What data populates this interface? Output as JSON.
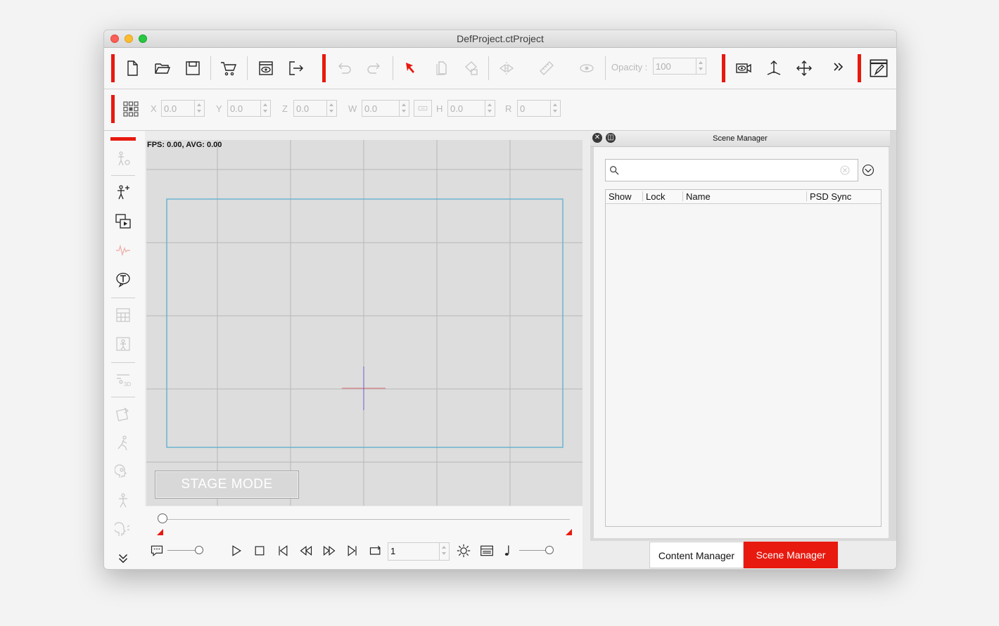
{
  "window": {
    "title": "DefProject.ctProject"
  },
  "toolbar": {
    "opacity_label": "Opacity :",
    "opacity_value": "100",
    "icons": [
      "new-file-icon",
      "open-folder-icon",
      "save-icon",
      "cart-icon",
      "preview-icon",
      "export-icon",
      "undo-icon",
      "redo-icon",
      "select-arrow-icon",
      "duplicate-icon",
      "paint-icon",
      "flip-icon",
      "ruler-icon",
      "eye-icon",
      "camera-view-icon",
      "anchor-icon",
      "move-icon",
      "more-icon",
      "edit-panel-icon"
    ]
  },
  "transform": {
    "x_label": "X",
    "x_value": "0.0",
    "y_label": "Y",
    "y_value": "0.0",
    "z_label": "Z",
    "z_value": "0.0",
    "w_label": "W",
    "w_value": "0.0",
    "h_label": "H",
    "h_value": "0.0",
    "r_label": "R",
    "r_value": "0"
  },
  "stage": {
    "fps_text": "FPS: 0.00, AVG: 0.00",
    "mode_button": "STAGE MODE"
  },
  "playback": {
    "frame_value": "1"
  },
  "scene_manager": {
    "title": "Scene Manager",
    "search_placeholder": "",
    "columns": [
      "Show",
      "Lock",
      "Name",
      "PSD Sync"
    ]
  },
  "tabs": [
    {
      "label": "Content Manager",
      "active": false
    },
    {
      "label": "Scene Manager",
      "active": true
    }
  ],
  "colors": {
    "accent": "#e8190f",
    "stage_bg": "#dddddd",
    "grid": "#b8b8b8",
    "camera_frame": "#5aaed0"
  }
}
